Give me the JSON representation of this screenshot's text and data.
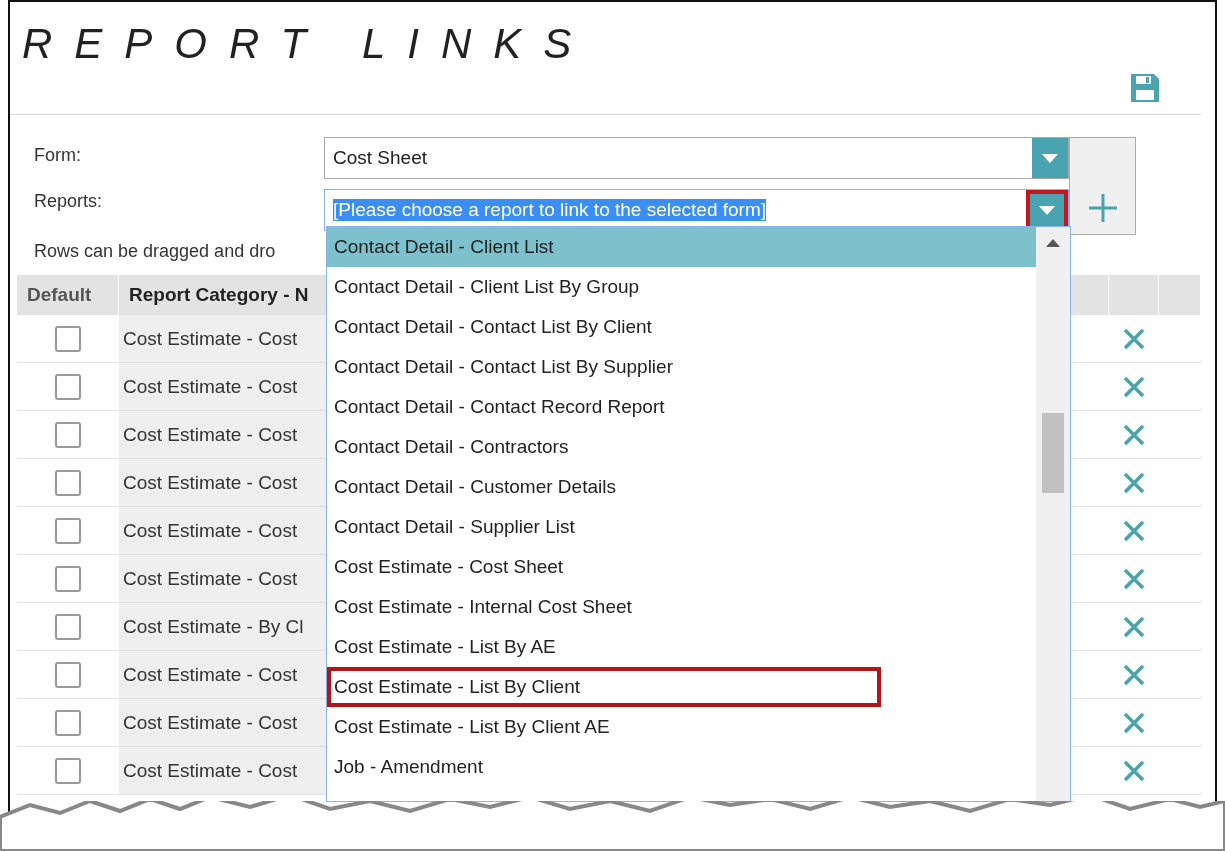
{
  "title": "REPORT LINKS",
  "form": {
    "label": "Form:",
    "value": "Cost Sheet"
  },
  "reports": {
    "label": "Reports:",
    "value": "[Please choose a report to link to the selected form]",
    "value_selected": true,
    "expanded": true,
    "button_highlighted": true
  },
  "note": "Rows can be dragged and dro",
  "table": {
    "columns": [
      "Default",
      "Report Category - N"
    ],
    "rows": [
      {
        "checked": false,
        "category": "Cost Estimate - Cost"
      },
      {
        "checked": false,
        "category": "Cost Estimate - Cost"
      },
      {
        "checked": false,
        "category": "Cost Estimate - Cost"
      },
      {
        "checked": false,
        "category": "Cost Estimate - Cost"
      },
      {
        "checked": false,
        "category": "Cost Estimate - Cost"
      },
      {
        "checked": false,
        "category": "Cost Estimate - Cost"
      },
      {
        "checked": false,
        "category": "Cost Estimate - By Cl"
      },
      {
        "checked": false,
        "category": "Cost Estimate - Cost"
      },
      {
        "checked": false,
        "category": "Cost Estimate - Cost"
      },
      {
        "checked": false,
        "category": "Cost Estimate - Cost"
      }
    ]
  },
  "dropdown_items": [
    {
      "label": "Contact Detail - Client List",
      "selected": true,
      "highlighted": false
    },
    {
      "label": "Contact Detail - Client List By Group",
      "selected": false,
      "highlighted": false
    },
    {
      "label": "Contact Detail - Contact List By Client",
      "selected": false,
      "highlighted": false
    },
    {
      "label": "Contact Detail - Contact List By Supplier",
      "selected": false,
      "highlighted": false
    },
    {
      "label": "Contact Detail - Contact Record Report",
      "selected": false,
      "highlighted": false
    },
    {
      "label": "Contact Detail - Contractors",
      "selected": false,
      "highlighted": false
    },
    {
      "label": "Contact Detail - Customer Details",
      "selected": false,
      "highlighted": false
    },
    {
      "label": "Contact Detail - Supplier List",
      "selected": false,
      "highlighted": false
    },
    {
      "label": "Cost Estimate - Cost Sheet",
      "selected": false,
      "highlighted": false
    },
    {
      "label": "Cost Estimate - Internal Cost Sheet",
      "selected": false,
      "highlighted": false
    },
    {
      "label": "Cost Estimate - List By AE",
      "selected": false,
      "highlighted": false
    },
    {
      "label": "Cost Estimate - List By Client",
      "selected": false,
      "highlighted": true
    },
    {
      "label": "Cost Estimate - List By Client AE",
      "selected": false,
      "highlighted": false
    },
    {
      "label": "Job - Amendment",
      "selected": false,
      "highlighted": false
    }
  ]
}
